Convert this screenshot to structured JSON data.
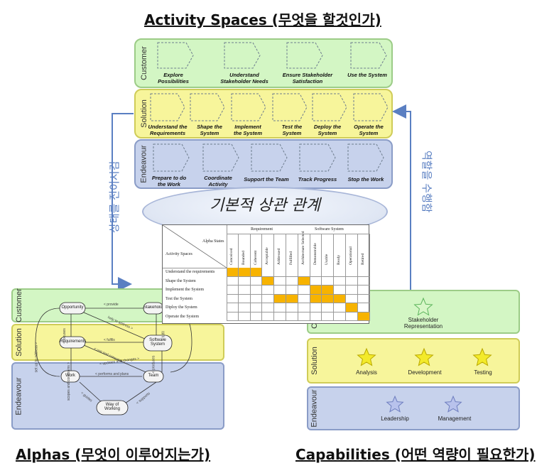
{
  "titles": {
    "activity_spaces": "Activity Spaces (무엇을 할것인가)",
    "alphas": "Alphas (무엇이 이루어지는가)",
    "capabilities": "Capabilities (어떤 역량이 필요한가)"
  },
  "bands": {
    "customer": "Customer",
    "solution": "Solution",
    "endeavour": "Endeavour"
  },
  "activity_spaces": {
    "customer": [
      "Explore Possibilities",
      "Understand Stakeholder Needs",
      "Ensure Stakeholder Satisfaction",
      "Use the System"
    ],
    "solution": [
      "Understand the Requirements",
      "Shape the System",
      "Implement the System",
      "Test the System",
      "Deploy the System",
      "Operate the System"
    ],
    "endeavour": [
      "Prepare to do the Work",
      "Coordinate Activity",
      "Support the Team",
      "Track Progress",
      "Stop the Work"
    ]
  },
  "arrows": {
    "left": "상태를 전이시킴",
    "right": "역할을 수행함"
  },
  "center_label": "기본적 상관 관계",
  "matrix": {
    "corner_top": "Alpha States",
    "corner_bottom": "Activity Spaces",
    "group_requirement": "Requirement",
    "group_software": "Software System",
    "columns": [
      "Conceived",
      "Bounded",
      "Coherent",
      "Acceptable",
      "Addressed",
      "Fulfilled",
      "Architecture Selected",
      "Demonstrable",
      "Usable",
      "Ready",
      "Operational",
      "Retired"
    ],
    "rows": [
      "Understand the requirements",
      "Shape the System",
      "Implement the System",
      "Test the System",
      "Diploy the System",
      "Operate the System"
    ],
    "filled": [
      [
        0,
        0
      ],
      [
        0,
        1
      ],
      [
        0,
        2
      ],
      [
        1,
        3
      ],
      [
        1,
        6
      ],
      [
        2,
        7
      ],
      [
        2,
        8
      ],
      [
        3,
        4
      ],
      [
        3,
        5
      ],
      [
        3,
        7
      ],
      [
        3,
        8
      ],
      [
        3,
        9
      ],
      [
        4,
        10
      ],
      [
        5,
        11
      ]
    ]
  },
  "alphas": {
    "nodes": [
      "Opportunity",
      "Stakeholders",
      "Requirements",
      "Software System",
      "Work",
      "Team",
      "Way of Working"
    ],
    "notes": [
      "< provide",
      "< fulfils",
      "< performs and plans",
      "< produces",
      "< guides",
      "< supports",
      "set up to address >",
      "< use and consume >",
      "help to address >",
      "< focuses",
      "scopes and constrains >",
      "< fulfil",
      "< updates and changes >"
    ]
  },
  "capabilities": {
    "customer": [
      "Stakeholder Representation"
    ],
    "solution": [
      "Analysis",
      "Development",
      "Testing"
    ],
    "endeavour": [
      "Leadership",
      "Management"
    ]
  },
  "colors": {
    "customer_band": "#d3f6c4",
    "solution_band": "#f7f59b",
    "endeavour_band": "#c7d2ec",
    "matrix_fill": "#f7b300",
    "arrow": "#5a7fc2"
  }
}
